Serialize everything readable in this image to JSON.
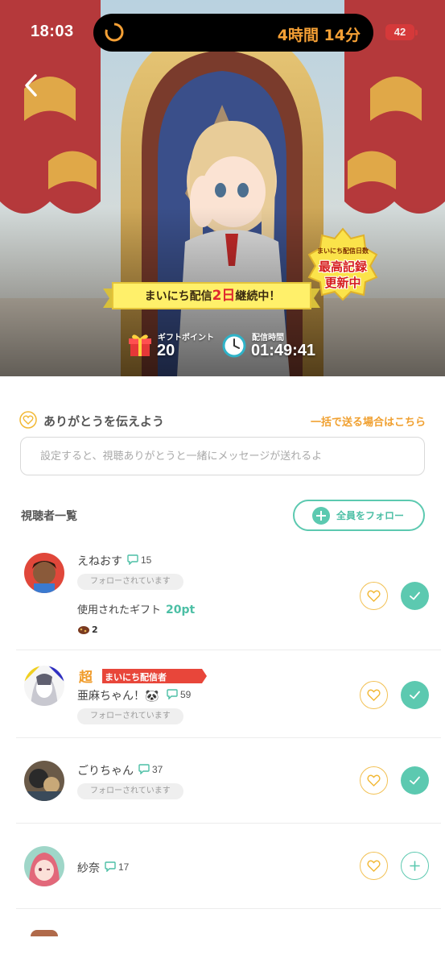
{
  "status_bar": {
    "time": "18:03",
    "island_text": "4時間 14分",
    "battery": "42"
  },
  "hero": {
    "streak_prefix": "まいにち配信",
    "streak_days": "2日",
    "streak_suffix": "継続中！",
    "badge_small": "まいにち配信日数",
    "badge_line1": "最高記録",
    "badge_line2": "更新中",
    "gift_points_label": "ギフトポイント",
    "gift_points_value": "20",
    "stream_time_label": "配信時間",
    "stream_time_value": "01:49:41"
  },
  "thanks": {
    "title": "ありがとうを伝えよう",
    "bulk_link": "一括で送る場合はこちら",
    "placeholder": "設定すると、視聴ありがとうと一緒にメッセージが送れるよ"
  },
  "viewers": {
    "title": "視聴者一覧",
    "follow_all": "全員をフォロー",
    "items": [
      {
        "name": "えねおす",
        "comments": "15",
        "follow_tag": "フォローされています",
        "gift_label": "使用されたギフト",
        "gift_points": "20pt",
        "gift_count": "2",
        "followed": true
      },
      {
        "name": "亜麻ちゃん！🐼",
        "comments": "59",
        "follow_tag": "フォローされています",
        "super_char": "超",
        "super_label": "まいにち配信者",
        "followed": true
      },
      {
        "name": "ごりちゃん",
        "comments": "37",
        "follow_tag": "フォローされています",
        "followed": true
      },
      {
        "name": "紗奈",
        "comments": "17",
        "followed": false
      }
    ]
  },
  "colors": {
    "accent_teal": "#5cc9b0",
    "accent_orange": "#f0a030",
    "heart_yellow": "#f2c154"
  }
}
